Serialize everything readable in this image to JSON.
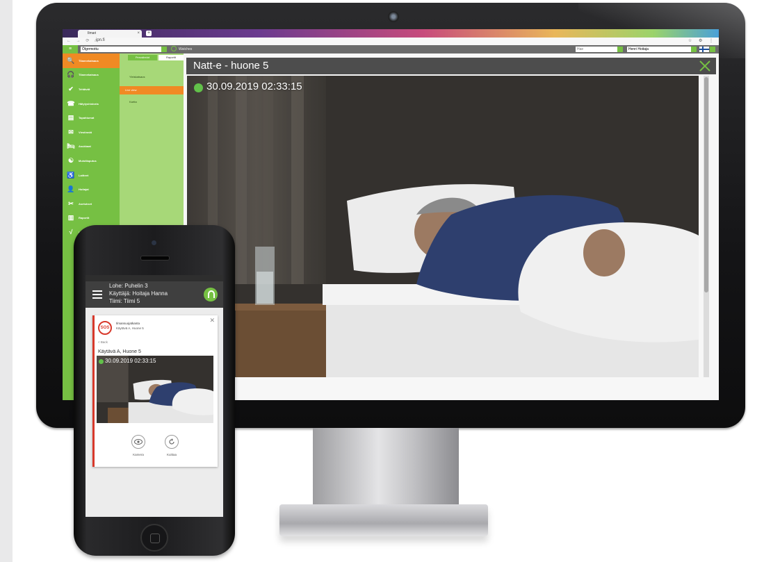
{
  "browser": {
    "tab_title": "Ilmari",
    "tab_close": "×",
    "new_tab": "+",
    "nav_icons": "← → ⟳ ⌂",
    "url": "ipn.fi",
    "actions": "☆ ⚙ ⋮"
  },
  "toolbar": {
    "menu_icon": "≡",
    "location_select": "Ölgrrmottu",
    "watch_label": "Watches",
    "search_placeholder": "Hae",
    "user_select": "Henri Hoitaja"
  },
  "sidebar": {
    "items": [
      {
        "label": "Tilannekatsaus",
        "icon": "search-icon",
        "glyph": "🔍",
        "active": true
      },
      {
        "label": "Tilannekatsaus",
        "icon": "headset-icon",
        "glyph": "🎧"
      },
      {
        "label": "Tehtävät",
        "icon": "check-icon",
        "glyph": "✔"
      },
      {
        "label": "Hälytyshistoria",
        "icon": "phone-icon",
        "glyph": "☎"
      },
      {
        "label": "Tapahtumat",
        "icon": "clipboard-icon",
        "glyph": "▤"
      },
      {
        "label": "Viestinnät",
        "icon": "mail-icon",
        "glyph": "✉"
      },
      {
        "label": "Asukkaat",
        "icon": "bed-icon",
        "glyph": "🛏"
      },
      {
        "label": "Muistilaputus",
        "icon": "dementia-icon",
        "glyph": "☯"
      },
      {
        "label": "Laitteet",
        "icon": "wheelchair-icon",
        "glyph": "♿"
      },
      {
        "label": "Hoitajat",
        "icon": "user-icon",
        "glyph": "👤"
      },
      {
        "label": "Asetukset",
        "icon": "tools-icon",
        "glyph": "✂"
      },
      {
        "label": "Raportit",
        "icon": "chart-icon",
        "glyph": "▥"
      },
      {
        "label": "Varmistus",
        "icon": "check-mark-icon",
        "glyph": "√"
      }
    ]
  },
  "subpanel": {
    "tabs": [
      "Perustiedot",
      "Raportit"
    ],
    "items": [
      {
        "label": "Yleiskatsaus",
        "active": false
      },
      {
        "label": "Live view",
        "active": true
      },
      {
        "label": "Kartta",
        "active": false
      }
    ]
  },
  "modal": {
    "title": "Natt-e - huone 5",
    "timestamp": "30.09.2019 02:33:15"
  },
  "phone": {
    "header_lines": [
      "Lohe: Puhelin 3",
      "Käyttäjä: Hoitaja Hanna",
      "Tiimi: Tiimi 5"
    ],
    "alert": {
      "badge": "SOS",
      "title": "Ilmansuojat­kanta",
      "subtitle": "Käytävä A, Huone 5",
      "back": "< Back",
      "room": "Käytävä A, Huone 5",
      "timestamp": "30.09.2019 02:33:15",
      "actions": [
        {
          "label": "Kamera",
          "icon": "eye-icon"
        },
        {
          "label": "Kuittaa",
          "icon": "refresh-icon"
        }
      ]
    }
  },
  "colors": {
    "accent_green": "#76c043",
    "accent_orange": "#f08a24",
    "live_green": "#62c14a",
    "alert_red": "#d8392b"
  }
}
